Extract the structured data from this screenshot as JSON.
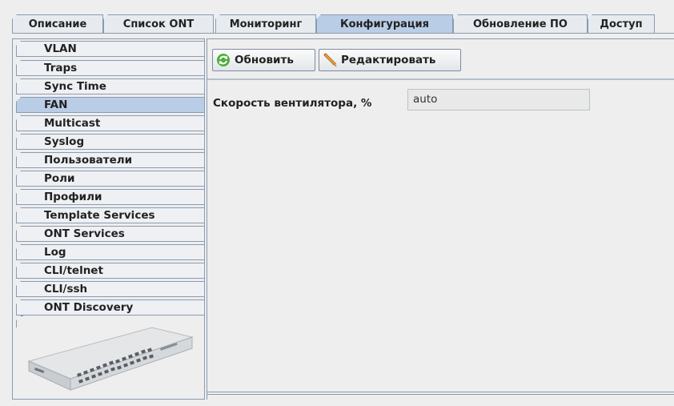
{
  "top_tabs": [
    {
      "label": "Описание",
      "active": false
    },
    {
      "label": "Список ONT",
      "active": false
    },
    {
      "label": "Мониторинг",
      "active": false
    },
    {
      "label": "Конфигурация",
      "active": true
    },
    {
      "label": "Обновление ПО",
      "active": false
    },
    {
      "label": "Доступ",
      "active": false
    }
  ],
  "side_tabs": [
    {
      "label": "VLAN",
      "active": false
    },
    {
      "label": "Traps",
      "active": false
    },
    {
      "label": "Sync Time",
      "active": false
    },
    {
      "label": "FAN",
      "active": true
    },
    {
      "label": "Multicast",
      "active": false
    },
    {
      "label": "Syslog",
      "active": false
    },
    {
      "label": "Пользователи",
      "active": false
    },
    {
      "label": "Роли",
      "active": false
    },
    {
      "label": "Профили",
      "active": false
    },
    {
      "label": "Template Services",
      "active": false
    },
    {
      "label": "ONT Services",
      "active": false
    },
    {
      "label": "Log",
      "active": false
    },
    {
      "label": "CLI/telnet",
      "active": false
    },
    {
      "label": "CLI/ssh",
      "active": false
    },
    {
      "label": "ONT Discovery",
      "active": false
    }
  ],
  "toolbar": {
    "refresh_label": "Обновить",
    "refresh_icon": "refresh-icon",
    "edit_label": "Редактировать",
    "edit_icon": "pencil-icon"
  },
  "fan": {
    "speed_label": "Скорость вентилятора, %",
    "speed_value": "auto"
  },
  "colors": {
    "active_tab": "#b9cde6",
    "border": "#8a9bb0",
    "background": "#eeeeee"
  }
}
